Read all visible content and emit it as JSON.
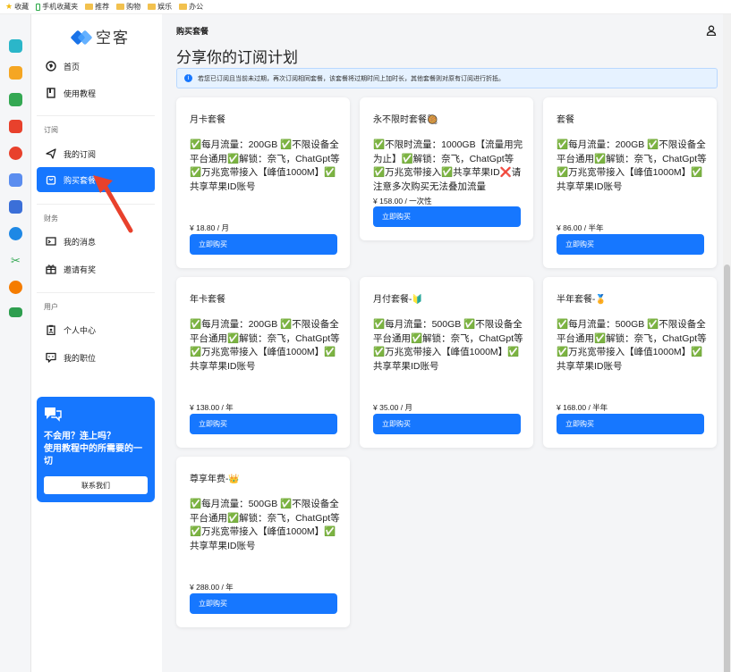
{
  "bookmarks": [
    {
      "label": "收藏",
      "icon": "star-icon"
    },
    {
      "label": "手机收藏夹",
      "icon": "phone-icon"
    },
    {
      "label": "推荐",
      "icon": "folder-icon"
    },
    {
      "label": "购物",
      "icon": "folder-icon"
    },
    {
      "label": "娱乐",
      "icon": "folder-icon"
    },
    {
      "label": "办公",
      "icon": "folder-icon"
    }
  ],
  "app": {
    "name": "空客"
  },
  "sidebar": {
    "home": "首页",
    "tutorial": "使用教程",
    "section_subscribe": "订阅",
    "my_subscription": "我的订阅",
    "buy_plan": "购买套餐",
    "section_finance": "财务",
    "my_messages": "我的消息",
    "invite": "邀请有奖",
    "section_user": "用户",
    "profile": "个人中心",
    "my_tickets": "我的职位",
    "help_title": "不会用？连上吗？",
    "help_body": "使用教程中的所需要的一切",
    "help_button": "联系我们"
  },
  "header": {
    "breadcrumb": "购买套餐",
    "title": "分享你的订阅计划",
    "notice": "若您已订阅且当前未过期，再次订阅相同套餐，该套餐将过期时间上加时长，其他套餐则对原有订阅进行折抵。"
  },
  "buy_label": "立即购买",
  "plans": [
    {
      "title": "月卡套餐",
      "desc": "✅每月流量：200GB ✅不限设备全平台通用✅解锁：奈飞，ChatGpt等✅万兆宽带接入【峰值1000M】✅共享苹果ID账号",
      "price": "¥ 18.80 / 月"
    },
    {
      "title": "永不限时套餐🥘",
      "desc": "✅不限时流量：1000GB【流量用完为止】✅解锁：奈飞，ChatGpt等✅万兆宽带接入✅共享苹果ID❌请注意多次购买无法叠加流量",
      "price": "¥ 158.00 / 一次性"
    },
    {
      "title": "套餐",
      "desc": "✅每月流量：200GB ✅不限设备全平台通用✅解锁：奈飞，ChatGpt等✅万兆宽带接入【峰值1000M】✅共享苹果ID账号",
      "price": "¥ 86.00 / 半年"
    },
    {
      "title": "年卡套餐",
      "desc": "✅每月流量：200GB ✅不限设备全平台通用✅解锁：奈飞，ChatGpt等✅万兆宽带接入【峰值1000M】✅共享苹果ID账号",
      "price": "¥ 138.00 / 年"
    },
    {
      "title": "月付套餐-🔰",
      "desc": "✅每月流量：500GB ✅不限设备全平台通用✅解锁：奈飞，ChatGpt等 ✅万兆宽带接入【峰值1000M】✅共享苹果ID账号",
      "price": "¥ 35.00 / 月"
    },
    {
      "title": "半年套餐-🏅",
      "desc": "✅每月流量：500GB ✅不限设备全平台通用✅解锁：奈飞，ChatGpt等 ✅万兆宽带接入【峰值1000M】✅共享苹果ID账号",
      "price": "¥ 168.00 / 半年"
    },
    {
      "title": "尊享年费-👑",
      "desc": "✅每月流量：500GB ✅不限设备全平台通用✅解锁：奈飞，ChatGpt等 ✅万兆宽带接入【峰值1000M】✅共享苹果ID账号",
      "price": "¥ 288.00 / 年"
    }
  ],
  "colors": {
    "accent": "#1677ff",
    "arrow": "#e8412c"
  }
}
